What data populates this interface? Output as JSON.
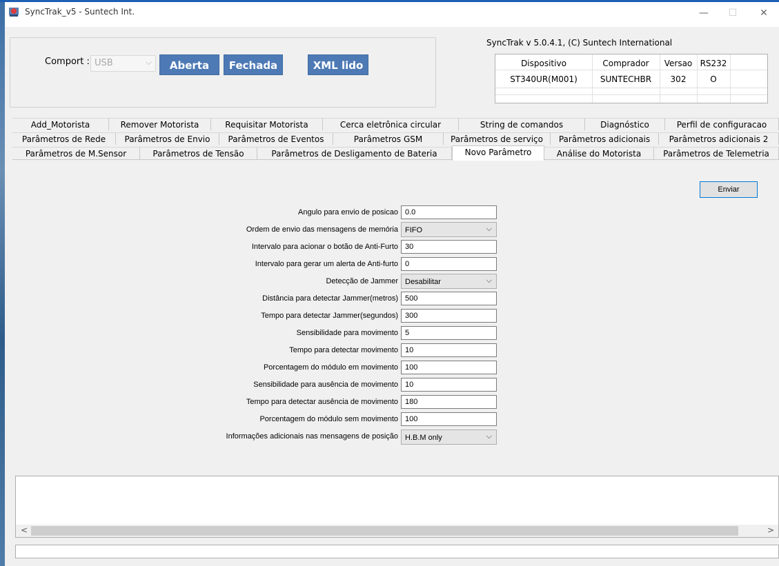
{
  "window": {
    "title": "SyncTrak_v5 - Suntech Int.",
    "minimize": "—",
    "maximize": "☐",
    "close": "✕"
  },
  "connection": {
    "comport_label": "Comport :",
    "comport_value": "USB",
    "open_button": "Aberta",
    "close_button": "Fechada",
    "xml_button": "XML lido"
  },
  "version": {
    "text": "SyncTrak v 5.0.4.1, (C) Suntech International",
    "headers": [
      "Dispositivo",
      "Comprador",
      "Versao",
      "RS232"
    ],
    "row": [
      "ST340UR(M001)",
      "SUNTECHBR",
      "302",
      "O"
    ]
  },
  "tabs": {
    "row1": [
      "Add_Motorista",
      "Remover Motorista",
      "Requisitar Motorista",
      "Cerca eletrônica circular",
      "String de comandos",
      "Diagnóstico",
      "Perfil de configuracao"
    ],
    "row2": [
      "Parâmetros de Rede",
      "Parâmetros de Envio",
      "Parâmetros de Eventos",
      "Parâmetros GSM",
      "Parâmetros de serviço",
      "Parâmetros adicionais",
      "Parâmetros adicionais 2"
    ],
    "row3": [
      "Parâmetros  de M.Sensor",
      "Parâmetros de Tensão",
      "Parâmetros de Desligamento de Bateria",
      "Novo Parâmetro",
      "Análise do Motorista",
      "Parâmetros de Telemetria"
    ],
    "active": "Novo Parâmetro"
  },
  "form": {
    "send_button": "Enviar",
    "fields": [
      {
        "label": "Angulo para envio de posicao",
        "value": "0.0",
        "type": "input"
      },
      {
        "label": "Ordem de envio das mensagens de memória",
        "value": "FIFO",
        "type": "select"
      },
      {
        "label": "Intervalo para acionar o botão de Anti-Furto",
        "value": "30",
        "type": "input"
      },
      {
        "label": "Intervalo para gerar um alerta de Anti-furto",
        "value": "0",
        "type": "input"
      },
      {
        "label": "Detecção de Jammer",
        "value": "Desabilitar",
        "type": "select"
      },
      {
        "label": "Distância para detectar Jammer(metros)",
        "value": "500",
        "type": "input"
      },
      {
        "label": "Tempo para detectar Jammer(segundos)",
        "value": "300",
        "type": "input"
      },
      {
        "label": "Sensibilidade para movimento",
        "value": "5",
        "type": "input"
      },
      {
        "label": "Tempo para detectar movimento",
        "value": "10",
        "type": "input"
      },
      {
        "label": "Porcentagem do módulo em movimento",
        "value": "100",
        "type": "input"
      },
      {
        "label": "Sensibilidade para ausência de movimento",
        "value": "10",
        "type": "input"
      },
      {
        "label": "Tempo para detectar ausência de movimento",
        "value": "180",
        "type": "input"
      },
      {
        "label": "Porcentagem do módulo sem movimento",
        "value": "100",
        "type": "input"
      },
      {
        "label": "Informações adicionais nas mensagens de posição",
        "value": "H.B.M only",
        "type": "select"
      }
    ]
  },
  "log": {
    "scroll_left": "<",
    "scroll_right": ">"
  }
}
